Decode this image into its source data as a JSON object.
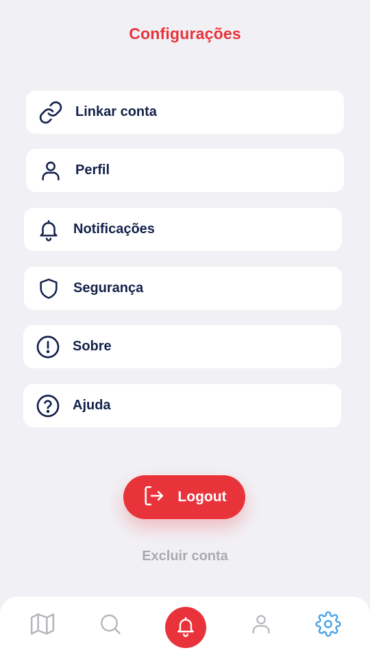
{
  "header": {
    "title": "Configurações"
  },
  "menu": {
    "items": [
      {
        "label": "Linkar conta",
        "icon": "link-icon"
      },
      {
        "label": "Perfil",
        "icon": "user-icon"
      },
      {
        "label": "Notificações",
        "icon": "bell-icon"
      },
      {
        "label": "Segurança",
        "icon": "shield-icon"
      },
      {
        "label": "Sobre",
        "icon": "info-circle-icon"
      },
      {
        "label": "Ajuda",
        "icon": "help-circle-icon"
      }
    ]
  },
  "actions": {
    "logout_label": "Logout",
    "delete_account_label": "Excluir conta"
  },
  "tabbar": {
    "tabs": [
      "map-icon",
      "search-icon",
      "bell-icon",
      "user-icon",
      "gear-icon"
    ],
    "active": "gear-icon"
  },
  "colors": {
    "accent": "#E8333A",
    "text": "#13214A",
    "background": "#F1F1F5",
    "muted": "#A9A9B0",
    "active_tab": "#4DA6E8",
    "inactive_tab": "#B5B5BC"
  }
}
